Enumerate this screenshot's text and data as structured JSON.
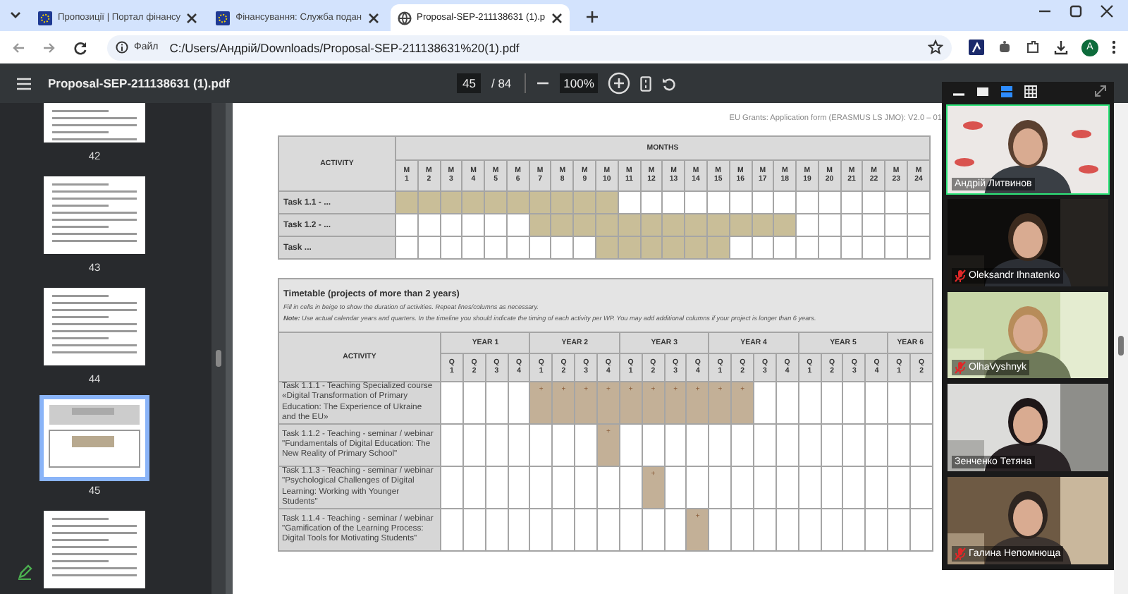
{
  "browser": {
    "tabs": [
      {
        "title": "Пропозиції | Портал фінансу",
        "selected": false
      },
      {
        "title": "Фінансування: Служба подан",
        "selected": false
      },
      {
        "title": "Proposal-SEP-211138631 (1).p",
        "selected": true
      }
    ],
    "address": {
      "chip": "Файл",
      "url": "C:/Users/Андрій/Downloads/Proposal-SEP-211138631%20(1).pdf"
    },
    "avatar": "A"
  },
  "pdf_toolbar": {
    "title": "Proposal-SEP-211138631 (1).pdf",
    "page": "45",
    "page_count": "/ 84",
    "zoom": "100%"
  },
  "thumbnails": [
    {
      "label": "42",
      "selected": false
    },
    {
      "label": "43",
      "selected": false
    },
    {
      "label": "44",
      "selected": false
    },
    {
      "label": "45",
      "selected": true
    },
    {
      "selected": false
    }
  ],
  "document": {
    "header": "EU Grants: Application form (ERASMUS LS JMO): V2.0 – 01",
    "month_table": {
      "activity": "ACTIVITY",
      "months_title": "MONTHS",
      "months": [
        "M 1",
        "M 2",
        "M 3",
        "M 4",
        "M 5",
        "M 6",
        "M 7",
        "M 8",
        "M 9",
        "M 10",
        "M 11",
        "M 12",
        "M 13",
        "M 14",
        "M 15",
        "M 16",
        "M 17",
        "M 18",
        "M 19",
        "M 20",
        "M 21",
        "M 22",
        "M 23",
        "M 24"
      ],
      "rows": [
        {
          "task": "Task 1.1 - ...",
          "filled": [
            true,
            true,
            true,
            true,
            true,
            true,
            true,
            true,
            true,
            true,
            false,
            false,
            false,
            false,
            false,
            false,
            false,
            false,
            false,
            false,
            false,
            false,
            false,
            false
          ]
        },
        {
          "task": "Task 1.2 - ...",
          "filled": [
            false,
            false,
            false,
            false,
            false,
            false,
            true,
            true,
            true,
            true,
            true,
            true,
            true,
            true,
            true,
            true,
            true,
            true,
            false,
            false,
            false,
            false,
            false,
            false
          ]
        },
        {
          "task": "Task ...",
          "filled": [
            false,
            false,
            false,
            false,
            false,
            false,
            false,
            false,
            false,
            true,
            true,
            true,
            true,
            true,
            true,
            false,
            false,
            false,
            false,
            false,
            false,
            false,
            false,
            false
          ]
        }
      ]
    },
    "timetable": {
      "title": "Timetable (projects of more than 2 years)",
      "hint": "Fill in cells in beige to show the duration of activities. Repeat lines/columns as necessary.",
      "note": "**Note:** Use actual calendar years and quarters. In the timeline you should indicate the timing of each activity per WP. You may add additional columns if your project is longer than 6 years.",
      "activity": "ACTIVITY",
      "years": [
        {
          "label": "YEAR 1",
          "quarters": [
            "Q 1",
            "Q 2",
            "Q 3",
            "Q 4"
          ]
        },
        {
          "label": "YEAR 2",
          "quarters": [
            "Q 1",
            "Q 2",
            "Q 3",
            "Q 4"
          ]
        },
        {
          "label": "YEAR 3",
          "quarters": [
            "Q 1",
            "Q 2",
            "Q 3",
            "Q 4"
          ]
        },
        {
          "label": "YEAR 4",
          "quarters": [
            "Q 1",
            "Q 2",
            "Q 3",
            "Q 4"
          ]
        },
        {
          "label": "YEAR 5",
          "quarters": [
            "Q 1",
            "Q 2",
            "Q 3",
            "Q 4"
          ]
        },
        {
          "label": "YEAR 6",
          "quarters": [
            "Q 1",
            "Q 2"
          ]
        }
      ],
      "rows": [
        {
          "task": "Task 1.1.1 - Teaching Specialized course «Digital Transformation of Primary Education: The Experience of Ukraine and the EU»",
          "cells": [
            {
              "filled": false
            },
            {
              "filled": false
            },
            {
              "filled": false
            },
            {
              "filled": false
            },
            {
              "filled": true,
              "text": "+"
            },
            {
              "filled": true,
              "text": "+"
            },
            {
              "filled": true,
              "text": "+"
            },
            {
              "filled": true,
              "text": "+"
            },
            {
              "filled": true,
              "text": "+"
            },
            {
              "filled": true,
              "text": "+"
            },
            {
              "filled": true,
              "text": "+"
            },
            {
              "filled": true,
              "text": "+"
            },
            {
              "filled": true,
              "text": "+"
            },
            {
              "filled": true,
              "text": "+"
            },
            {
              "filled": false
            },
            {
              "filled": false
            },
            {
              "filled": false
            },
            {
              "filled": false
            },
            {
              "filled": false
            },
            {
              "filled": false
            },
            {
              "filled": false
            },
            {
              "filled": false
            }
          ]
        },
        {
          "task": "Task 1.1.2 - Teaching - seminar / webinar \"Fundamentals of Digital Education: The New Reality of Primary School\"",
          "cells": [
            {
              "filled": false
            },
            {
              "filled": false
            },
            {
              "filled": false
            },
            {
              "filled": false
            },
            {
              "filled": false
            },
            {
              "filled": false
            },
            {
              "filled": false
            },
            {
              "filled": true,
              "text": "+"
            },
            {
              "filled": false
            },
            {
              "filled": false
            },
            {
              "filled": false
            },
            {
              "filled": false
            },
            {
              "filled": false
            },
            {
              "filled": false
            },
            {
              "filled": false
            },
            {
              "filled": false
            },
            {
              "filled": false
            },
            {
              "filled": false
            },
            {
              "filled": false
            },
            {
              "filled": false
            },
            {
              "filled": false
            },
            {
              "filled": false
            }
          ]
        },
        {
          "task": "Task 1.1.3 - Teaching - seminar / webinar \"Psychological Challenges of Digital Learning: Working with Younger Students\"",
          "cells": [
            {
              "filled": false
            },
            {
              "filled": false
            },
            {
              "filled": false
            },
            {
              "filled": false
            },
            {
              "filled": false
            },
            {
              "filled": false
            },
            {
              "filled": false
            },
            {
              "filled": false
            },
            {
              "filled": false
            },
            {
              "filled": true,
              "text": "+"
            },
            {
              "filled": false
            },
            {
              "filled": false
            },
            {
              "filled": false
            },
            {
              "filled": false
            },
            {
              "filled": false
            },
            {
              "filled": false
            },
            {
              "filled": false
            },
            {
              "filled": false
            },
            {
              "filled": false
            },
            {
              "filled": false
            },
            {
              "filled": false
            },
            {
              "filled": false
            }
          ]
        },
        {
          "task": "Task 1.1.4 - Teaching - seminar / webinar \"Gamification of the Learning Process: Digital Tools for Motivating Students\"",
          "cells": [
            {
              "filled": false
            },
            {
              "filled": false
            },
            {
              "filled": false
            },
            {
              "filled": false
            },
            {
              "filled": false
            },
            {
              "filled": false
            },
            {
              "filled": false
            },
            {
              "filled": false
            },
            {
              "filled": false
            },
            {
              "filled": false
            },
            {
              "filled": false
            },
            {
              "filled": true,
              "text": "+"
            },
            {
              "filled": false
            },
            {
              "filled": false
            },
            {
              "filled": false
            },
            {
              "filled": false
            },
            {
              "filled": false
            },
            {
              "filled": false
            },
            {
              "filled": false
            },
            {
              "filled": false
            },
            {
              "filled": false
            },
            {
              "filled": false
            }
          ]
        }
      ]
    }
  },
  "video_call": {
    "participants": [
      {
        "name": "Андрій Литвинов",
        "muted": false,
        "selected": true
      },
      {
        "name": "Oleksandr Ihnatenko",
        "muted": true,
        "selected": false
      },
      {
        "name": "OlhaVyshnyk",
        "muted": true,
        "selected": false
      },
      {
        "name": "Зенченко Тетяна",
        "muted": false,
        "selected": false
      },
      {
        "name": "Галина Непомнюща",
        "muted": true,
        "selected": false
      }
    ]
  }
}
